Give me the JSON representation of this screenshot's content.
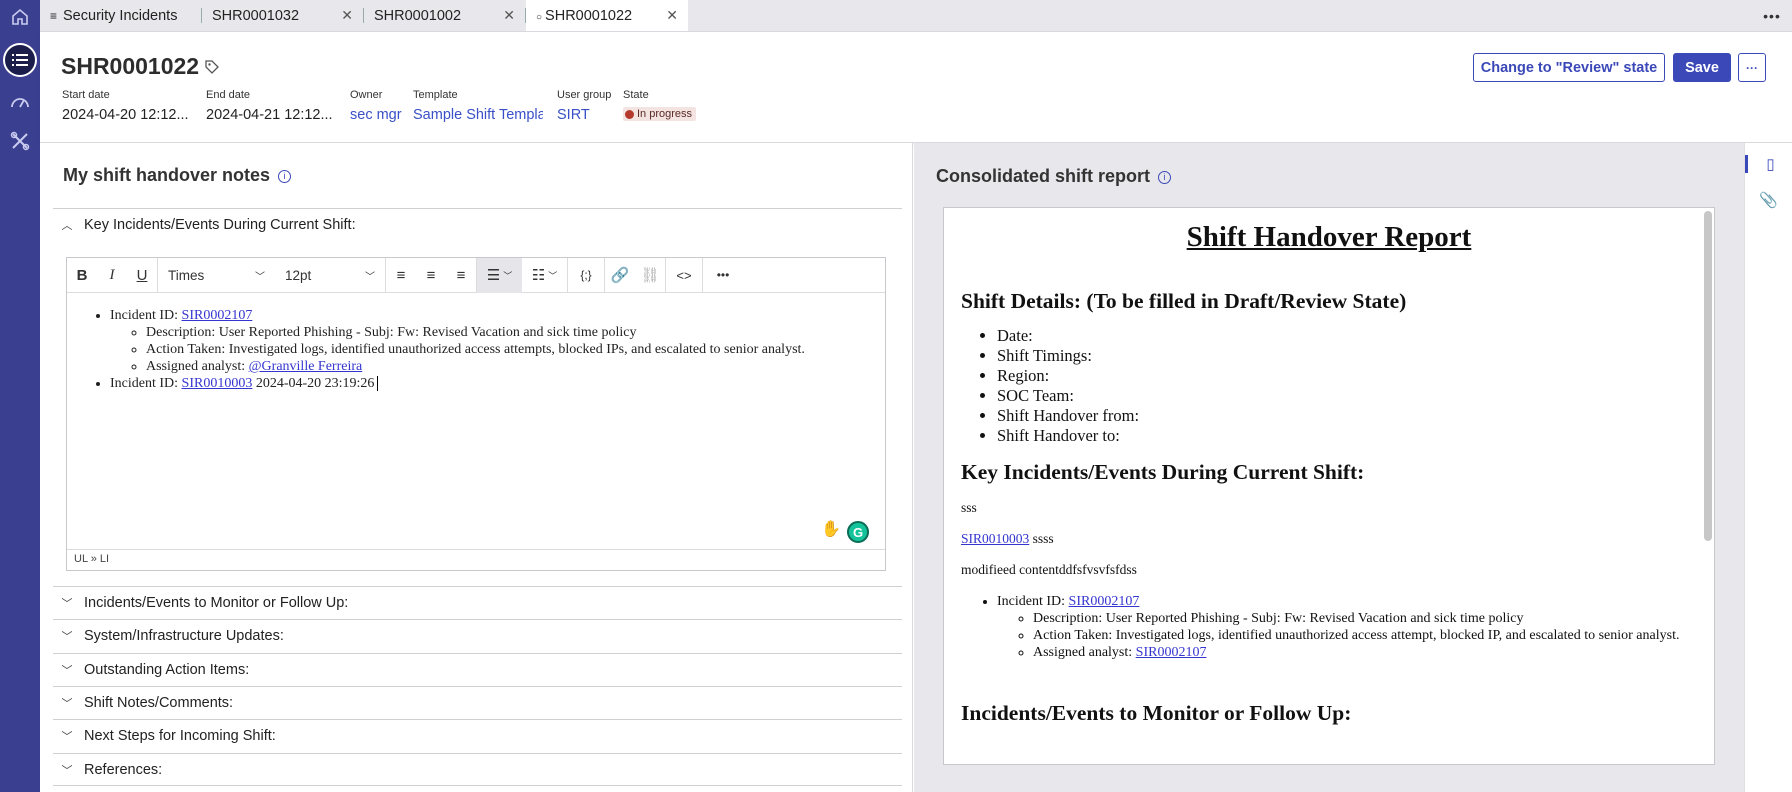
{
  "tabs": {
    "list_tab": "Security Incidents",
    "items": [
      "SHR0001032",
      "SHR0001002",
      "SHR0001022"
    ]
  },
  "record": {
    "number": "SHR0001022",
    "fields": {
      "start_label": "Start date",
      "start_value": "2024-04-20 12:12...",
      "end_label": "End date",
      "end_value": "2024-04-21 12:12...",
      "owner_label": "Owner",
      "owner_value": "sec mgr",
      "template_label": "Template",
      "template_value": "Sample Shift Templat",
      "group_label": "User group",
      "group_value": "SIRT",
      "state_label": "State",
      "state_value": "In progress"
    },
    "actions": {
      "review": "Change to \"Review\" state",
      "save": "Save",
      "more": "···"
    }
  },
  "left": {
    "title": "My shift handover notes",
    "sections": [
      "Key Incidents/Events During Current Shift:",
      "Incidents/Events to Monitor or Follow Up:",
      "System/Infrastructure Updates:",
      "Outstanding Action Items:",
      "Shift Notes/Comments:",
      "Next Steps for Incoming Shift:",
      "References:"
    ],
    "editor": {
      "font": "Times",
      "size": "12pt",
      "incident1_prefix": "Incident ID: ",
      "incident1_link": "SIR0002107",
      "desc": "Description: User Reported Phishing - Subj: Fw: Revised Vacation and sick time policy",
      "action": "Action Taken: Investigated logs, identified unauthorized access attempts, blocked IPs, and escalated to senior analyst.",
      "analyst_prefix": "Assigned analyst: ",
      "analyst_link": "@Granville Ferreira",
      "incident2_prefix": "Incident ID: ",
      "incident2_link": "SIR0010003",
      "incident2_suffix": " 2024-04-20 23:19:26",
      "path": "UL » LI"
    }
  },
  "right": {
    "title": "Consolidated shift report",
    "report": {
      "h1": "Shift Handover Report",
      "details_h": "Shift Details: (To be filled in Draft/Review State)",
      "details": [
        "Date:",
        "Shift Timings:",
        "Region:",
        "SOC Team:",
        "Shift Handover from:",
        "Shift Handover to:"
      ],
      "key_h": "Key Incidents/Events During Current Shift:",
      "p1": "sss",
      "p2_link": "SIR0010003",
      "p2_rest": " ssss",
      "p3": "modifieed contentddfsfvsvfsfdss",
      "inc_prefix": "Incident ID: ",
      "inc_link": "SIR0002107",
      "desc": "Description: User Reported Phishing - Subj: Fw: Revised Vacation and sick time policy",
      "action": "Action Taken: Investigated logs, identified unauthorized access attempt, blocked IP, and escalated to senior analyst.",
      "analyst_prefix": "Assigned analyst: ",
      "analyst_link": "SIR0002107",
      "monitor_h": "Incidents/Events to Monitor or Follow Up:"
    }
  },
  "colors": {
    "rail": "#3b3f8f",
    "accent": "#3b49b8",
    "state_dot": "#b33a2c"
  }
}
